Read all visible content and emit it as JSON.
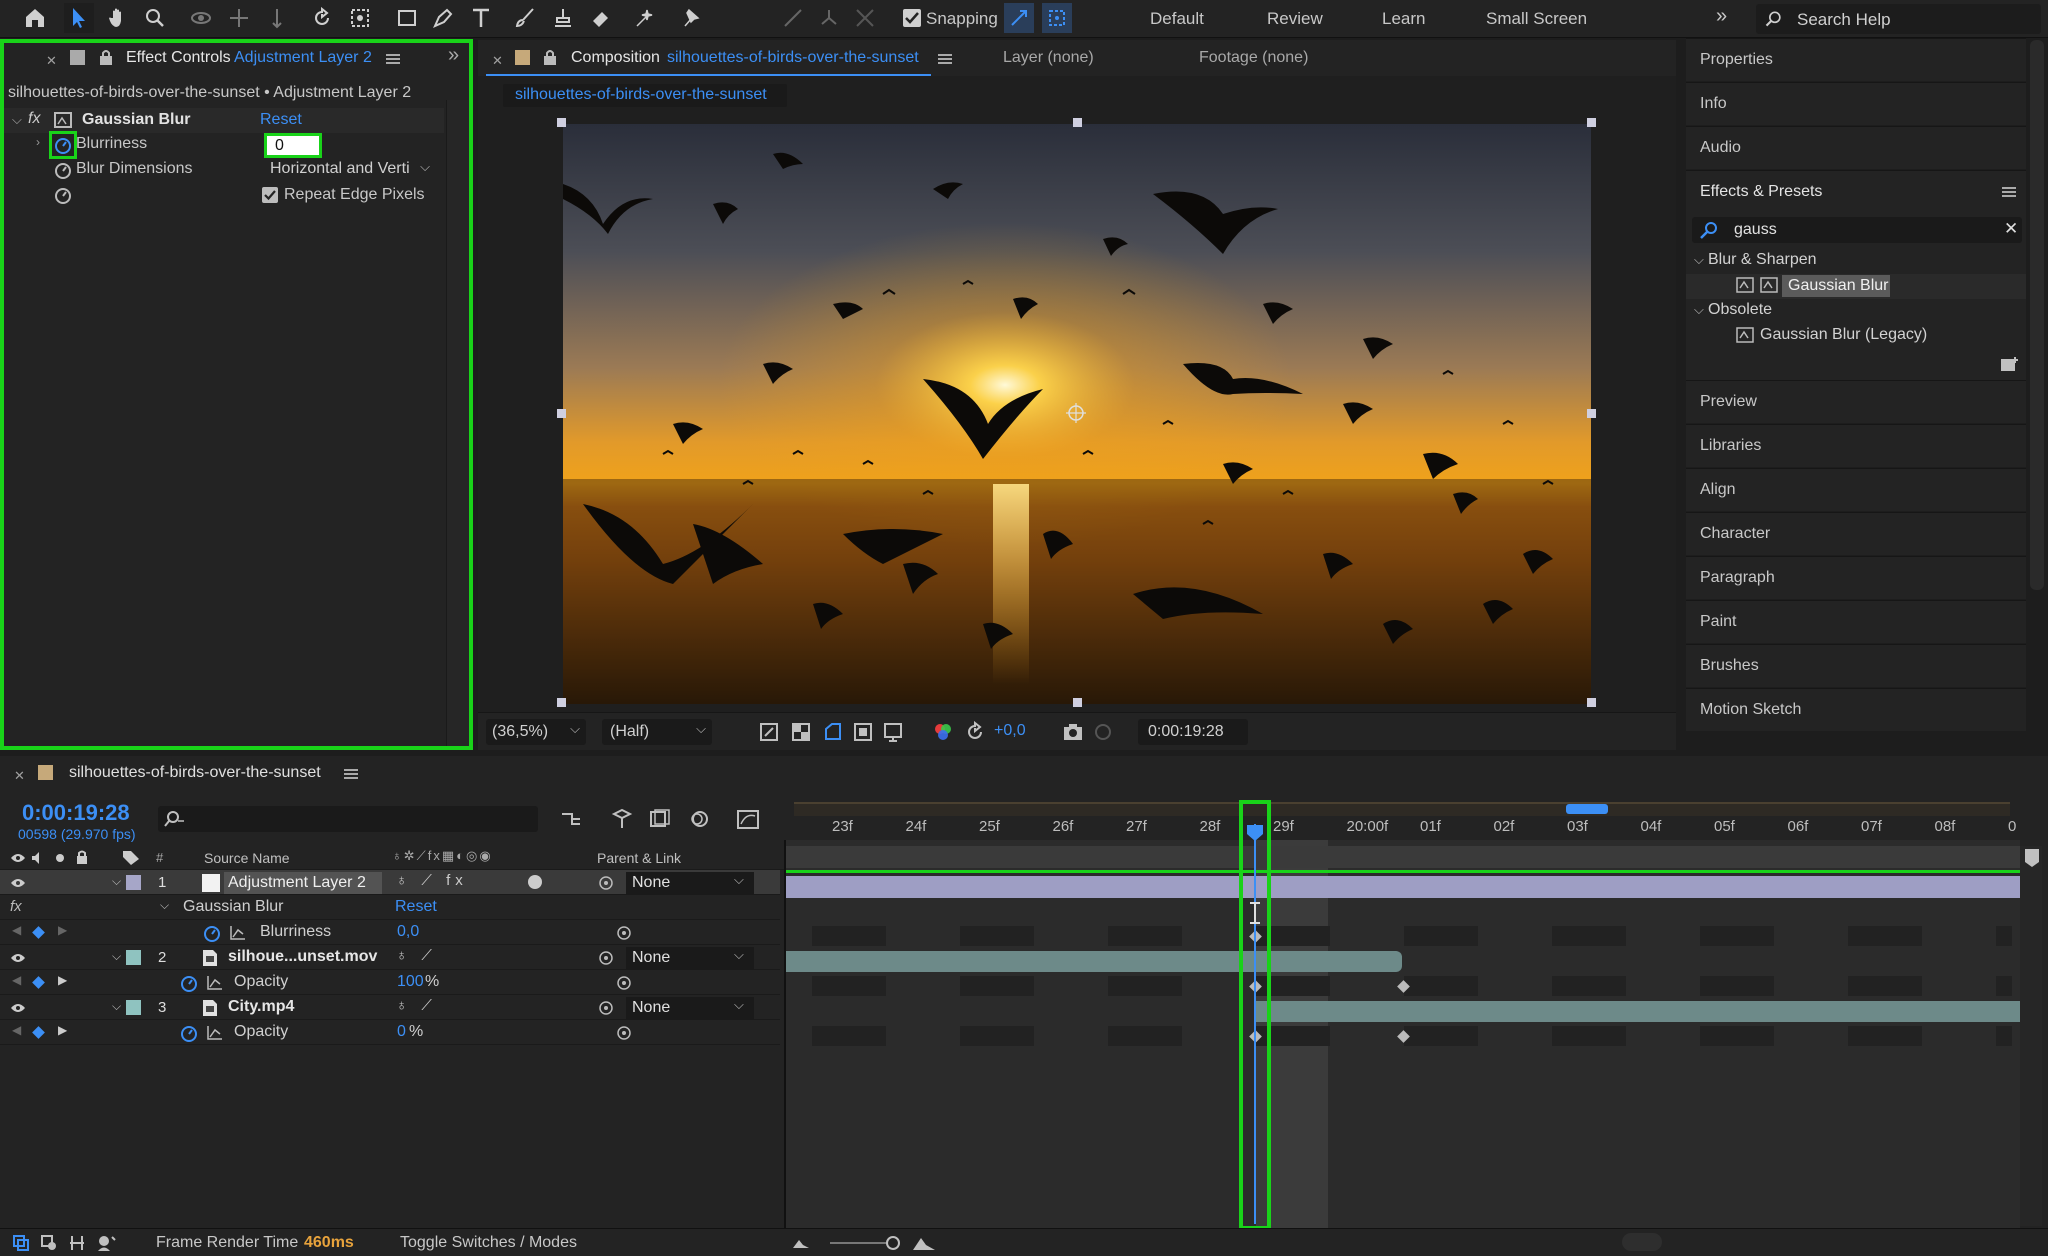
{
  "toolbar": {
    "snapping_label": "Snapping",
    "workspaces": [
      "Default",
      "Review",
      "Learn",
      "Small Screen"
    ],
    "overflow": "»",
    "search_help_label": "Search Help"
  },
  "effect_controls": {
    "tab_label": "Effect Controls",
    "tab_layer": "Adjustment Layer 2",
    "breadcrumb": "silhouettes-of-birds-over-the-sunset • Adjustment Layer 2",
    "effect_name": "Gaussian Blur",
    "reset_label": "Reset",
    "fx_label": "fx",
    "blurriness_label": "Blurriness",
    "blurriness_value": "0",
    "blur_dimensions_label": "Blur Dimensions",
    "blur_dimensions_value": "Horizontal and Verti",
    "repeat_edge_label": "Repeat Edge Pixels"
  },
  "composition": {
    "tab_label": "Composition",
    "tab_name": "silhouettes-of-birds-over-the-sunset",
    "layer_tab": "Layer (none)",
    "footage_tab": "Footage (none)",
    "subtab": "silhouettes-of-birds-over-the-sunset",
    "zoom": "(36,5%)",
    "resolution": "(Half)",
    "exposure": "+0,0",
    "timecode": "0:00:19:28"
  },
  "right_panel": {
    "items_top": [
      "Properties",
      "Info",
      "Audio"
    ],
    "effects_presets_label": "Effects & Presets",
    "search_value": "gauss",
    "groups": [
      {
        "name": "Blur & Sharpen",
        "items": [
          "Gaussian Blur"
        ]
      },
      {
        "name": "Obsolete",
        "items": [
          "Gaussian Blur (Legacy)"
        ]
      }
    ],
    "items_bottom": [
      "Preview",
      "Libraries",
      "Align",
      "Character",
      "Paragraph",
      "Paint",
      "Brushes",
      "Motion Sketch"
    ]
  },
  "timeline": {
    "comp_name": "silhouettes-of-birds-over-the-sunset",
    "timecode": "0:00:19:28",
    "frame_info": "00598 (29.970 fps)",
    "col_source_name": "Source Name",
    "col_parent": "Parent & Link",
    "col_num": "#",
    "ruler": [
      "23f",
      "24f",
      "25f",
      "26f",
      "27f",
      "28f",
      "29f",
      "20:00f",
      "01f",
      "02f",
      "03f",
      "04f",
      "05f",
      "06f",
      "07f",
      "08f",
      "0"
    ],
    "layers": [
      {
        "num": "1",
        "name": "Adjustment Layer 2",
        "parent": "None"
      },
      {
        "num": "2",
        "name": "silhoue...unset.mov",
        "parent": "None"
      },
      {
        "num": "3",
        "name": "City.mp4",
        "parent": "None"
      }
    ],
    "effect_group": "Gaussian Blur",
    "effect_reset": "Reset",
    "prop_blurriness": "Blurriness",
    "prop_blurriness_value": "0,0",
    "prop_opacity": "Opacity",
    "opacity_2_value": "100",
    "opacity_3_value": "0",
    "percent": "%"
  },
  "status": {
    "frame_render_label": "Frame Render Time",
    "frame_render_value": "460ms",
    "toggle_label": "Toggle Switches / Modes"
  },
  "colors": {
    "accent_blue": "#3c8ff5",
    "highlight_green": "#19d319",
    "render_time_orange": "#e8a33c"
  }
}
